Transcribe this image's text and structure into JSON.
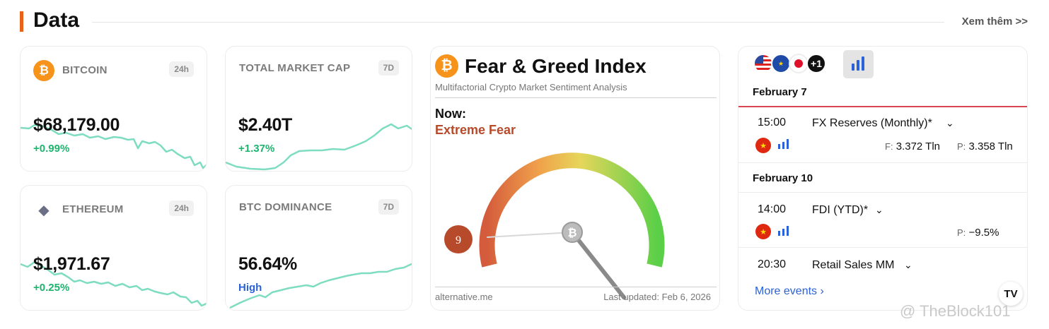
{
  "header": {
    "title": "Data",
    "more_label": "Xem thêm >>"
  },
  "cards": {
    "bitcoin": {
      "label": "BITCOIN",
      "period": "24h",
      "price": "$68,179.00",
      "change": "+0.99%",
      "icon_symbol": "₿",
      "icon_color": "#f7931a",
      "change_color": "#1db46e"
    },
    "ethereum": {
      "label": "ETHEREUM",
      "period": "24h",
      "price": "$1,971.67",
      "change": "+0.25%",
      "icon_symbol": "◆",
      "icon_color": "#6a6f85"
    },
    "market_cap": {
      "label": "TOTAL MARKET CAP",
      "period": "7D",
      "value": "$2.40T",
      "change": "+1.37%"
    },
    "dominance": {
      "label": "BTC DOMINANCE",
      "period": "7D",
      "value": "56.64%",
      "status": "High",
      "status_color": "#2b62d6"
    }
  },
  "fear_greed": {
    "title": "Fear & Greed Index",
    "subtitle": "Multifactorial Crypto Market Sentiment Analysis",
    "now_label": "Now:",
    "status": "Extreme Fear",
    "value": "9",
    "value_numeric": 9,
    "source": "alternative.me",
    "updated": "Last updated: Feb 6, 2026",
    "needle_icon": "₿"
  },
  "calendar": {
    "more_flags": "+1",
    "chart_icon": "bar-chart-icon",
    "groups": [
      {
        "date": "February 7",
        "events": [
          {
            "time": "15:00",
            "name": "FX Reserves (Monthly)*",
            "forecast_label": "F:",
            "forecast": "3.372 Tln",
            "previous_label": "P:",
            "previous": "3.358 Tln"
          }
        ]
      },
      {
        "date": "February 10",
        "events": [
          {
            "time": "14:00",
            "name": "FDI (YTD)*",
            "previous_label": "P:",
            "previous": "−9.5%"
          },
          {
            "time": "20:30",
            "name": "Retail Sales MM"
          }
        ]
      }
    ],
    "more_events": "More events",
    "tv_logo": "TV"
  },
  "watermark": "@ TheBlock101",
  "colors": {
    "accent": "#e8621a",
    "positive": "#1db46e",
    "sparkline": "#7edcc0",
    "link": "#2b62d6",
    "fear": "#b74a2a"
  }
}
